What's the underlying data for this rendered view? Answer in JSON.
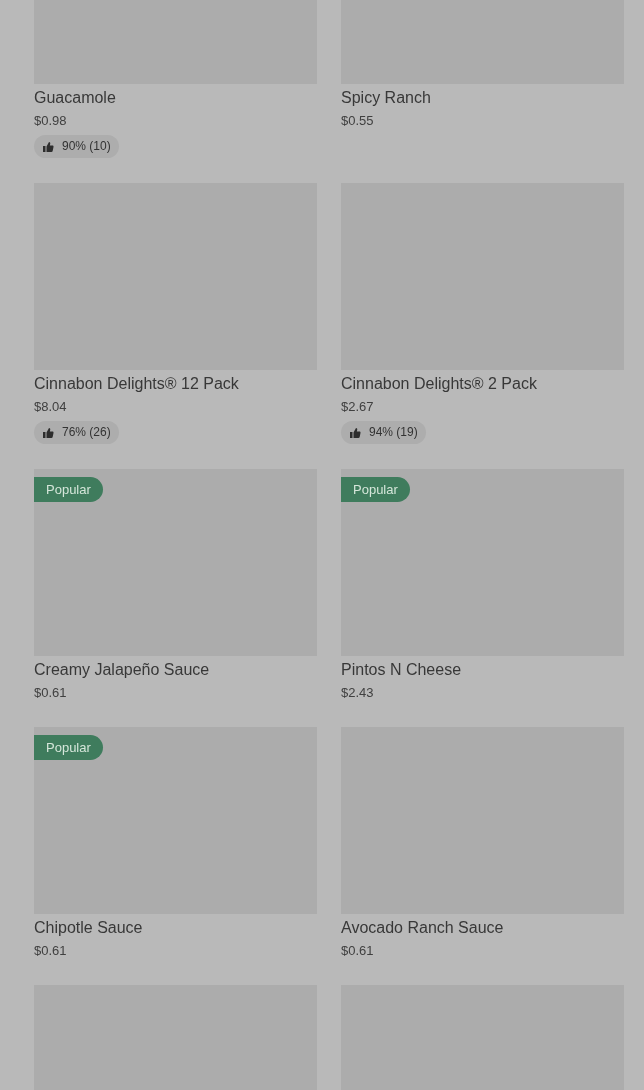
{
  "items": [
    {
      "name": "Guacamole",
      "price": "$0.98",
      "rating": "90% (10)"
    },
    {
      "name": "Spicy Ranch",
      "price": "$0.55"
    },
    {
      "name": "Cinnabon Delights® 12 Pack",
      "price": "$8.04",
      "rating": "76% (26)",
      "popular": false
    },
    {
      "name": "Cinnabon Delights® 2 Pack",
      "price": "$2.67",
      "rating": "94% (19)",
      "popular": false
    },
    {
      "name": "Creamy Jalapeño Sauce",
      "price": "$0.61",
      "popular": true,
      "badge": "Popular"
    },
    {
      "name": "Pintos N Cheese",
      "price": "$2.43",
      "popular": true,
      "badge": "Popular"
    },
    {
      "name": "Chipotle Sauce",
      "price": "$0.61",
      "popular": true,
      "badge": "Popular"
    },
    {
      "name": "Avocado Ranch Sauce",
      "price": "$0.61",
      "popular": false
    },
    {
      "popular": false
    },
    {
      "popular": false
    }
  ]
}
